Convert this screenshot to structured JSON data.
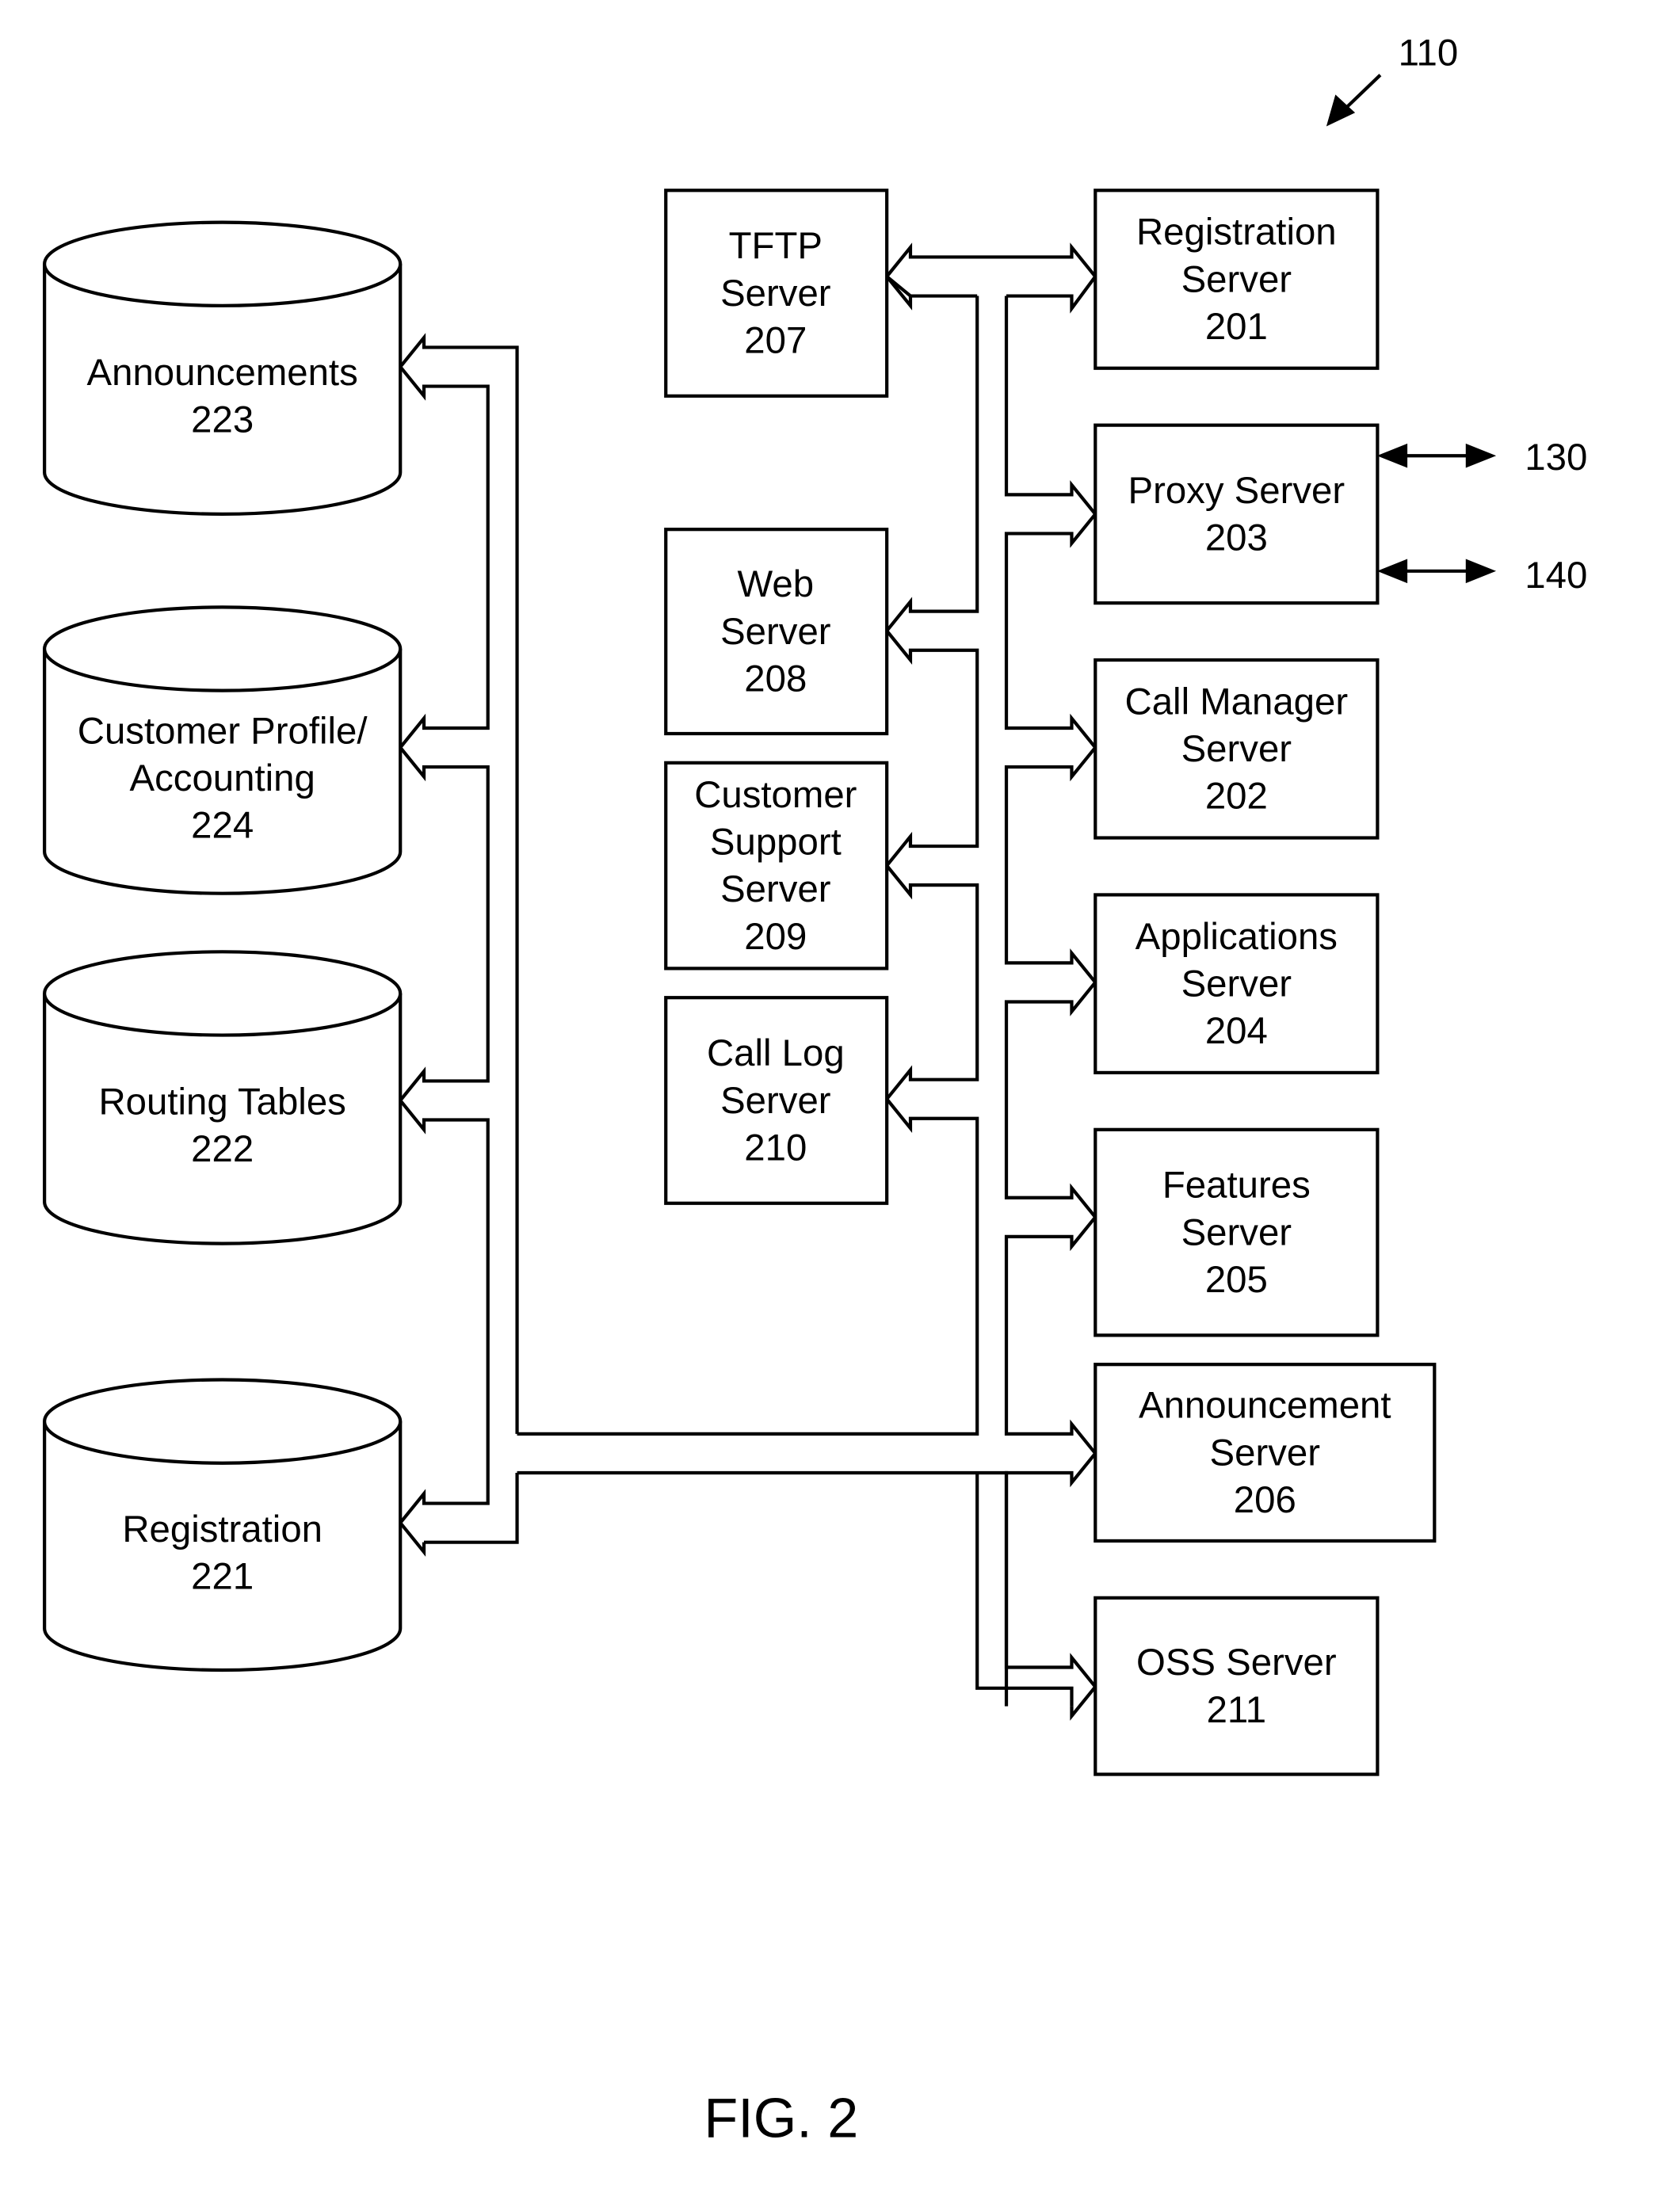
{
  "figure": {
    "caption": "FIG. 2",
    "reference_label": "110"
  },
  "external_links": [
    {
      "label": "130"
    },
    {
      "label": "140"
    }
  ],
  "servers_middle": [
    {
      "id": "tftp",
      "lines": [
        "TFTP",
        "Server",
        "207"
      ]
    },
    {
      "id": "web",
      "lines": [
        "Web",
        "Server",
        "208"
      ]
    },
    {
      "id": "customer-support",
      "lines": [
        "Customer",
        "Support",
        "Server",
        "209"
      ]
    },
    {
      "id": "call-log",
      "lines": [
        "Call Log",
        "Server",
        "210"
      ]
    }
  ],
  "servers_right": [
    {
      "id": "registration",
      "lines": [
        "Registration",
        "Server",
        "201"
      ]
    },
    {
      "id": "proxy",
      "lines": [
        "Proxy Server",
        "203"
      ]
    },
    {
      "id": "call-manager",
      "lines": [
        "Call Manager",
        "Server",
        "202"
      ]
    },
    {
      "id": "applications",
      "lines": [
        "Applications",
        "Server",
        "204"
      ]
    },
    {
      "id": "features",
      "lines": [
        "Features",
        "Server",
        "205"
      ]
    },
    {
      "id": "announcement",
      "lines": [
        "Announcement",
        "Server",
        "206"
      ]
    },
    {
      "id": "oss",
      "lines": [
        "OSS Server",
        "211"
      ]
    }
  ],
  "databases": [
    {
      "id": "announcements",
      "lines": [
        "Announcements",
        "223"
      ]
    },
    {
      "id": "customer-profile",
      "lines": [
        "Customer Profile/",
        "Accounting",
        "224"
      ]
    },
    {
      "id": "routing-tables",
      "lines": [
        "Routing Tables",
        "222"
      ]
    },
    {
      "id": "registration-db",
      "lines": [
        "Registration",
        "221"
      ]
    }
  ]
}
